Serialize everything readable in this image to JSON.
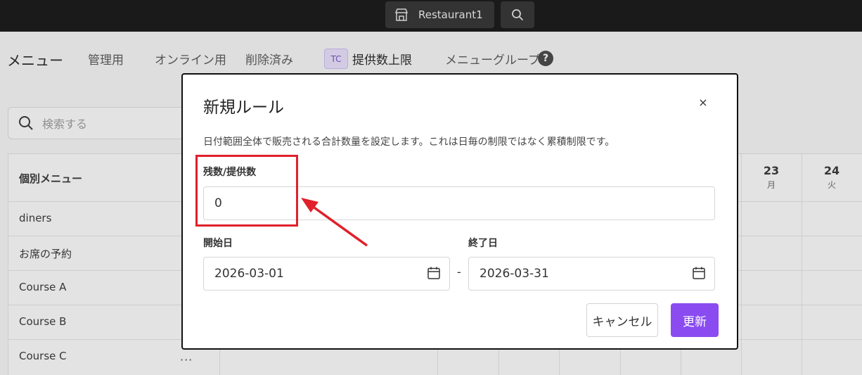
{
  "topbar": {
    "store_name": "Restaurant1"
  },
  "nav": {
    "title": "メニュー",
    "items": [
      "管理用",
      "オンライン用",
      "削除済み"
    ],
    "tc_badge": "TC",
    "active_item": "提供数上限",
    "menu_group": "メニューグループ",
    "help": "?"
  },
  "page": {
    "search_placeholder": "検索する",
    "table_header": "個別メニュー",
    "rows": [
      "diners",
      "お席の予約",
      "Course A",
      "Course B",
      "Course C"
    ],
    "days": [
      {
        "num": "23",
        "weekday": "月"
      },
      {
        "num": "24",
        "weekday": "火"
      }
    ],
    "row_menu": "···"
  },
  "modal": {
    "title": "新規ルール",
    "close": "×",
    "description": "日付範囲全体で販売される合計数量を設定します。これは日毎の制限ではなく累積制限です。",
    "quantity_label": "残数/提供数",
    "quantity_value": "0",
    "start_label": "開始日",
    "start_value": "2026-03-01",
    "end_label": "終了日",
    "end_value": "2026-03-31",
    "separator": "-",
    "cancel": "キャンセル",
    "update": "更新"
  },
  "colors": {
    "accent": "#8a4cf0",
    "annotation": "#e0202b",
    "topbar": "#1a1a1a"
  }
}
